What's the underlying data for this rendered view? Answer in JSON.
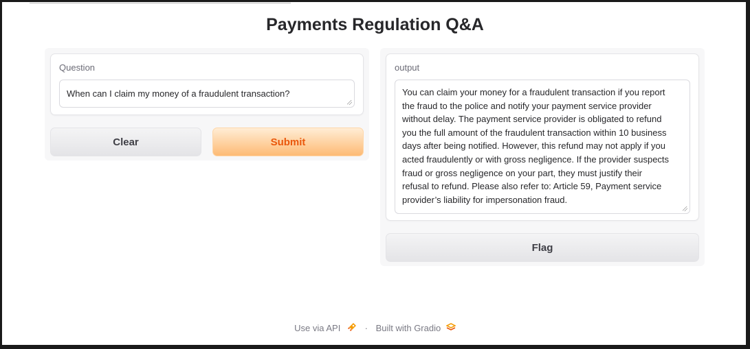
{
  "app": {
    "title": "Payments Regulation Q&A"
  },
  "input": {
    "label": "Question",
    "value": "When can I claim my money of a fraudulent transaction?"
  },
  "buttons": {
    "clear": "Clear",
    "submit": "Submit",
    "flag": "Flag"
  },
  "output": {
    "label": "output",
    "value": "You can claim your money for a fraudulent transaction if you report the fraud to the police and notify your payment service provider without delay. The payment service provider is obligated to refund you the full amount of the fraudulent transaction within 10 business days after being notified. However, this refund may not apply if you acted fraudulently or with gross negligence. If the provider suspects fraud or gross negligence on your part, they must justify their refusal to refund. Please also refer to: Article 59, Payment service provider’s liability for impersonation fraud."
  },
  "footer": {
    "api_link": "Use via API",
    "separator": "·",
    "built_with": "Built with Gradio"
  },
  "colors": {
    "accent": "#ea580c",
    "primary_button_gradient_top": "#ffedd5",
    "primary_button_gradient_bottom": "#fdba74"
  },
  "icons": {
    "api": "rocket-icon",
    "gradio": "gradio-logo-icon"
  }
}
